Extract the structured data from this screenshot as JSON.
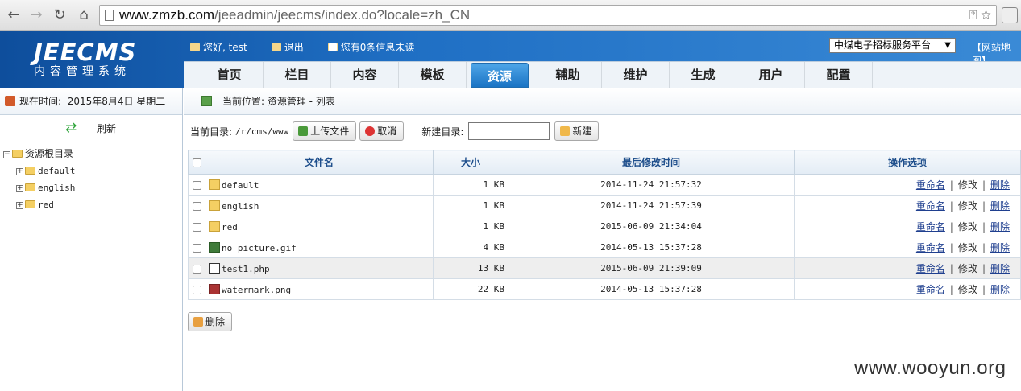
{
  "browser": {
    "url_domain": "www.zmzb.com",
    "url_path": "/jeeadmin/jeecms/index.do?locale=zh_CN"
  },
  "header": {
    "logo_main": "JEECMS",
    "logo_sub": "内容管理系统",
    "greeting": "您好, test",
    "logout": "退出",
    "messages": "您有0条信息未读",
    "site_select": "中煤电子招标服务平台",
    "sitemap": "【网站地图】"
  },
  "menu": [
    "首页",
    "栏目",
    "内容",
    "模板",
    "资源",
    "辅助",
    "维护",
    "生成",
    "用户",
    "配置"
  ],
  "menu_active": "资源",
  "left": {
    "date_label": "现在时间:",
    "date_value": "2015年8月4日 星期二",
    "refresh": "刷新",
    "tree_root": "资源根目录",
    "tree_children": [
      "default",
      "english",
      "red"
    ]
  },
  "breadcrumb": "当前位置: 资源管理 - 列表",
  "toolbar": {
    "current_dir_label": "当前目录:",
    "current_dir": "/r/cms/www",
    "upload": "上传文件",
    "cancel": "取消",
    "new_dir_label": "新建目录:",
    "new_dir_value": "",
    "new_button": "新建"
  },
  "table": {
    "headers": [
      "文件名",
      "大小",
      "最后修改时间",
      "操作选项"
    ],
    "rows": [
      {
        "icon": "folder-icon",
        "name": "default",
        "size": "1 KB",
        "mtime": "2014-11-24 21:57:32"
      },
      {
        "icon": "folder-icon",
        "name": "english",
        "size": "1 KB",
        "mtime": "2014-11-24 21:57:39"
      },
      {
        "icon": "folder-icon",
        "name": "red",
        "size": "1 KB",
        "mtime": "2015-06-09 21:34:04"
      },
      {
        "icon": "gif-file-icon",
        "name": "no_picture.gif",
        "size": "4 KB",
        "mtime": "2014-05-13 15:37:28"
      },
      {
        "icon": "php-file-icon",
        "name": "test1.php",
        "size": "13 KB",
        "mtime": "2015-06-09 21:39:09"
      },
      {
        "icon": "png-file-icon",
        "name": "watermark.png",
        "size": "22 KB",
        "mtime": "2014-05-13 15:37:28"
      }
    ],
    "actions": [
      "重命名",
      "修改",
      "删除"
    ]
  },
  "delete_button": "删除",
  "watermark": "www.wooyun.org"
}
